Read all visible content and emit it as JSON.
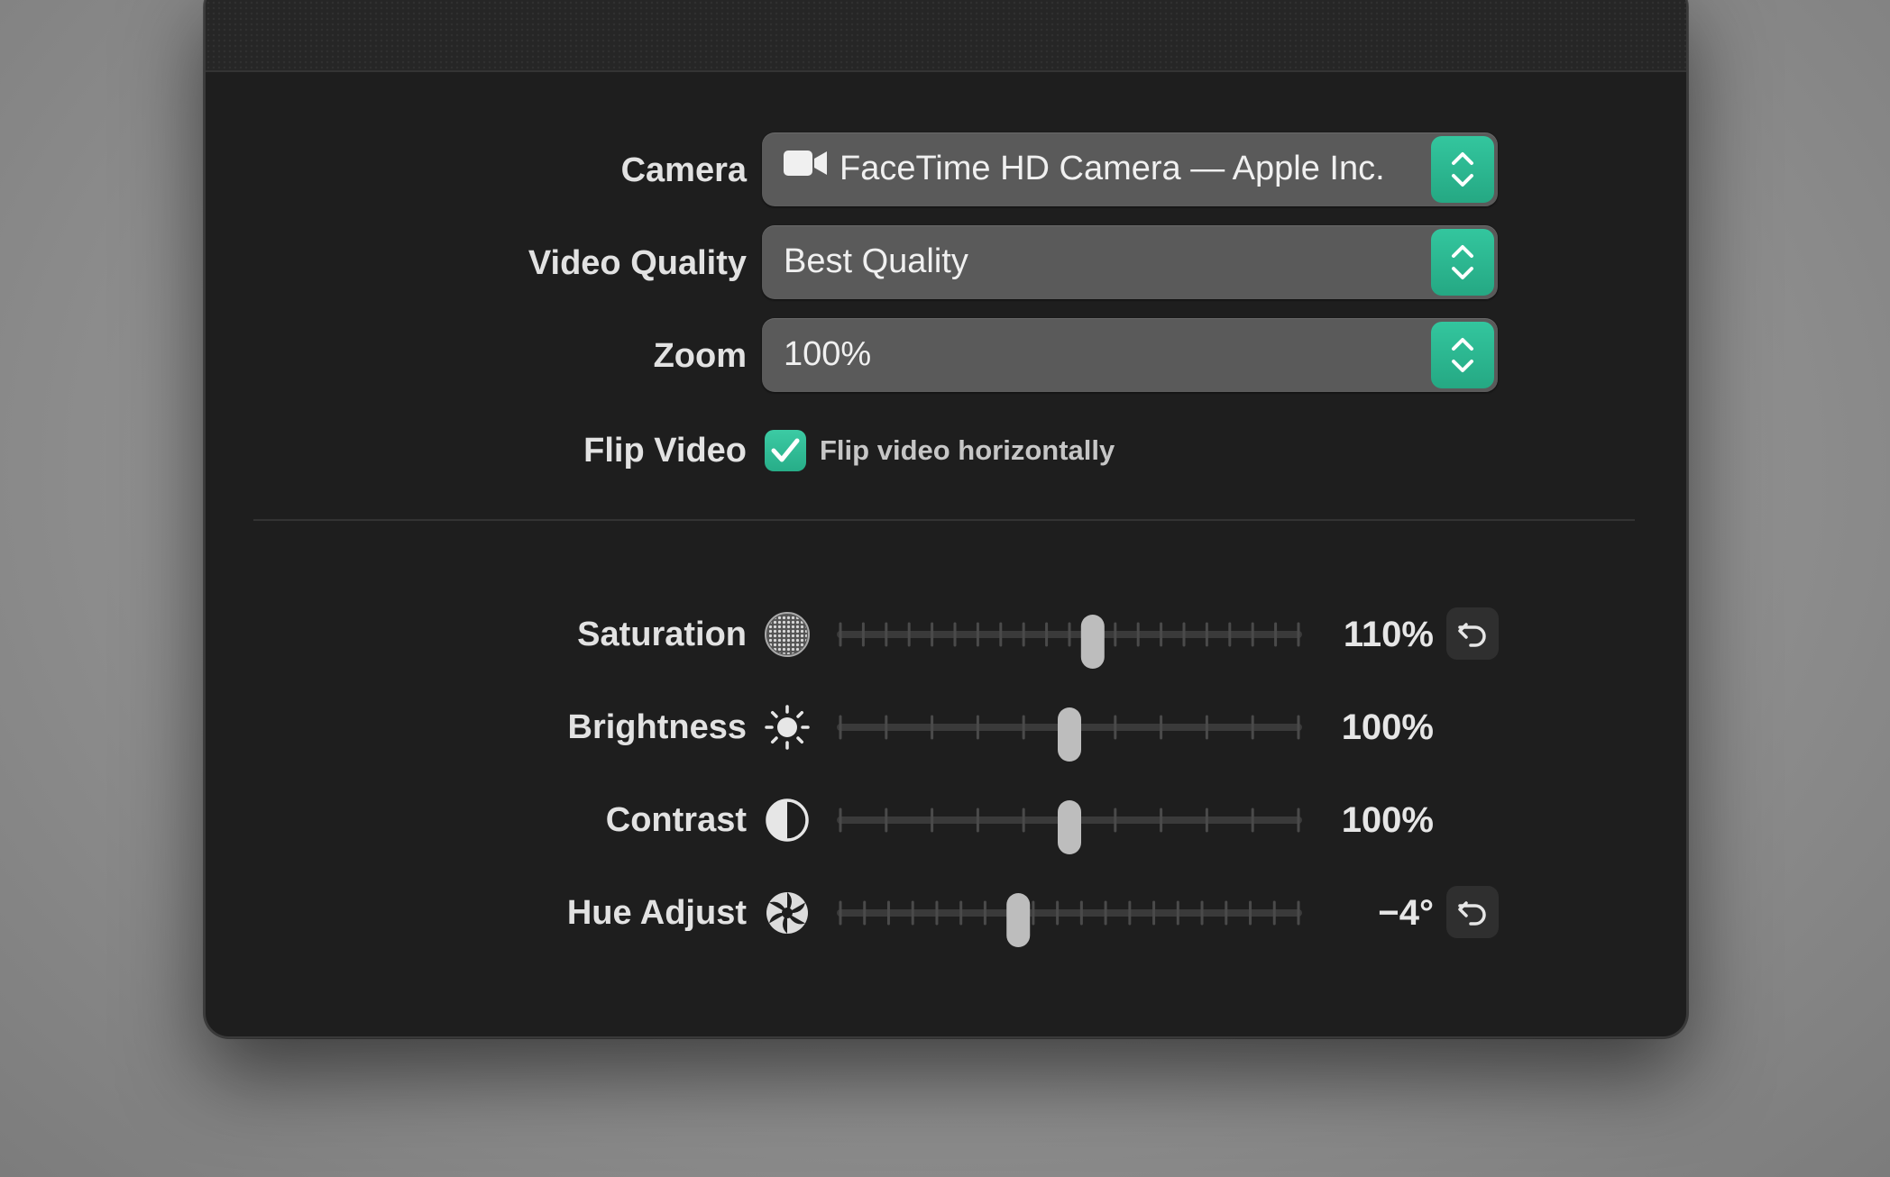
{
  "form": {
    "camera": {
      "label": "Camera",
      "value": "FaceTime HD Camera — Apple Inc.",
      "icon": "video-camera-icon"
    },
    "video_quality": {
      "label": "Video Quality",
      "value": "Best Quality"
    },
    "zoom": {
      "label": "Zoom",
      "value": "100%"
    },
    "flip_video": {
      "label": "Flip Video",
      "checkbox_label": "Flip video horizontally",
      "checked": true
    }
  },
  "adjustments": [
    {
      "key": "saturation",
      "label": "Saturation",
      "icon": "saturation-icon",
      "value_text": "110%",
      "position": 0.55,
      "ticks": 21,
      "reset": true
    },
    {
      "key": "brightness",
      "label": "Brightness",
      "icon": "sun-icon",
      "value_text": "100%",
      "position": 0.5,
      "ticks": 11,
      "reset": false
    },
    {
      "key": "contrast",
      "label": "Contrast",
      "icon": "contrast-icon",
      "value_text": "100%",
      "position": 0.5,
      "ticks": 11,
      "reset": false
    },
    {
      "key": "hue",
      "label": "Hue Adjust",
      "icon": "hue-icon",
      "value_text": "−4°",
      "position": 0.39,
      "ticks": 20,
      "reset": true
    }
  ],
  "colors": {
    "accent": "#2bb892",
    "window_bg": "#1e1e1e",
    "popup_bg": "#5a5a5a",
    "text": "#e2e2e2"
  }
}
